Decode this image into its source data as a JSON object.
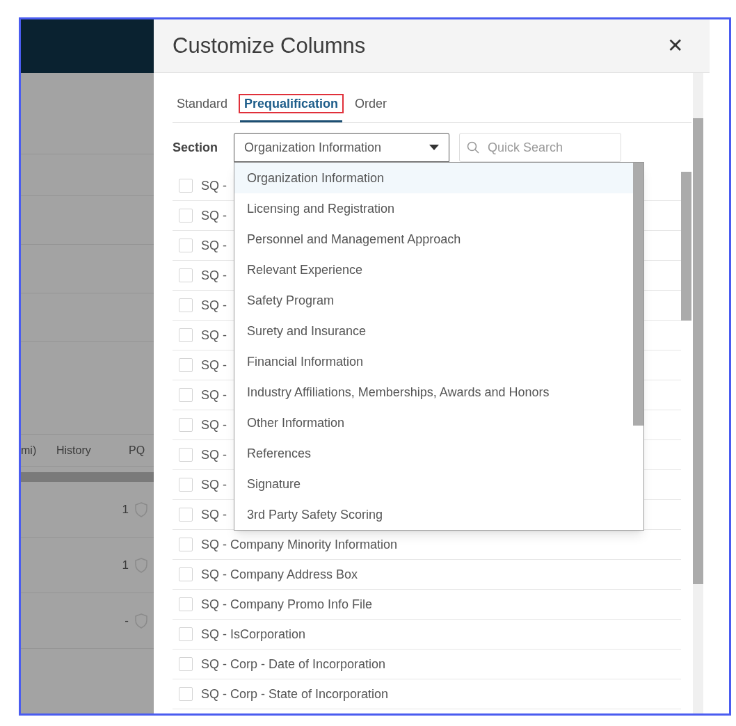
{
  "background": {
    "table_header": [
      "mi)",
      "History",
      "PQ"
    ],
    "rows": [
      {
        "count": "1"
      },
      {
        "count": "1"
      },
      {
        "count": "-"
      }
    ]
  },
  "dialog": {
    "title": "Customize Columns",
    "close": "✕",
    "tabs": [
      {
        "label": "Standard",
        "selected": false,
        "highlighted": false
      },
      {
        "label": "Prequalification",
        "selected": true,
        "highlighted": true
      },
      {
        "label": "Order",
        "selected": false,
        "highlighted": false
      }
    ],
    "section": {
      "label": "Section",
      "value": "Organization Information",
      "expanded": true,
      "options": [
        {
          "label": "Organization Information",
          "selected": true
        },
        {
          "label": "Licensing and Registration",
          "selected": false
        },
        {
          "label": "Personnel and Management Approach",
          "selected": false
        },
        {
          "label": "Relevant Experience",
          "selected": false
        },
        {
          "label": "Safety Program",
          "selected": false
        },
        {
          "label": "Surety and Insurance",
          "selected": false
        },
        {
          "label": "Financial Information",
          "selected": false
        },
        {
          "label": "Industry Affiliations, Memberships, Awards and Honors",
          "selected": false
        },
        {
          "label": "Other Information",
          "selected": false
        },
        {
          "label": "References",
          "selected": false
        },
        {
          "label": "Signature",
          "selected": false
        },
        {
          "label": "3rd Party Safety Scoring",
          "selected": false
        }
      ]
    },
    "search": {
      "placeholder": "Quick Search"
    },
    "columns": [
      {
        "label": "SQ -",
        "checked": false
      },
      {
        "label": "SQ -",
        "checked": false
      },
      {
        "label": "SQ -",
        "checked": false
      },
      {
        "label": "SQ -",
        "checked": false
      },
      {
        "label": "SQ -",
        "checked": false
      },
      {
        "label": "SQ -",
        "checked": false
      },
      {
        "label": "SQ -",
        "checked": false
      },
      {
        "label": "SQ -",
        "checked": false
      },
      {
        "label": "SQ -",
        "checked": false
      },
      {
        "label": "SQ -",
        "checked": false
      },
      {
        "label": "SQ -",
        "checked": false
      },
      {
        "label": "SQ -",
        "checked": false
      },
      {
        "label": "SQ - Company Minority Information",
        "checked": false
      },
      {
        "label": "SQ - Company Address Box",
        "checked": false
      },
      {
        "label": "SQ - Company Promo Info File",
        "checked": false
      },
      {
        "label": "SQ - IsCorporation",
        "checked": false
      },
      {
        "label": "SQ - Corp - Date of Incorporation",
        "checked": false
      },
      {
        "label": "SQ - Corp - State of Incorporation",
        "checked": false
      }
    ]
  }
}
